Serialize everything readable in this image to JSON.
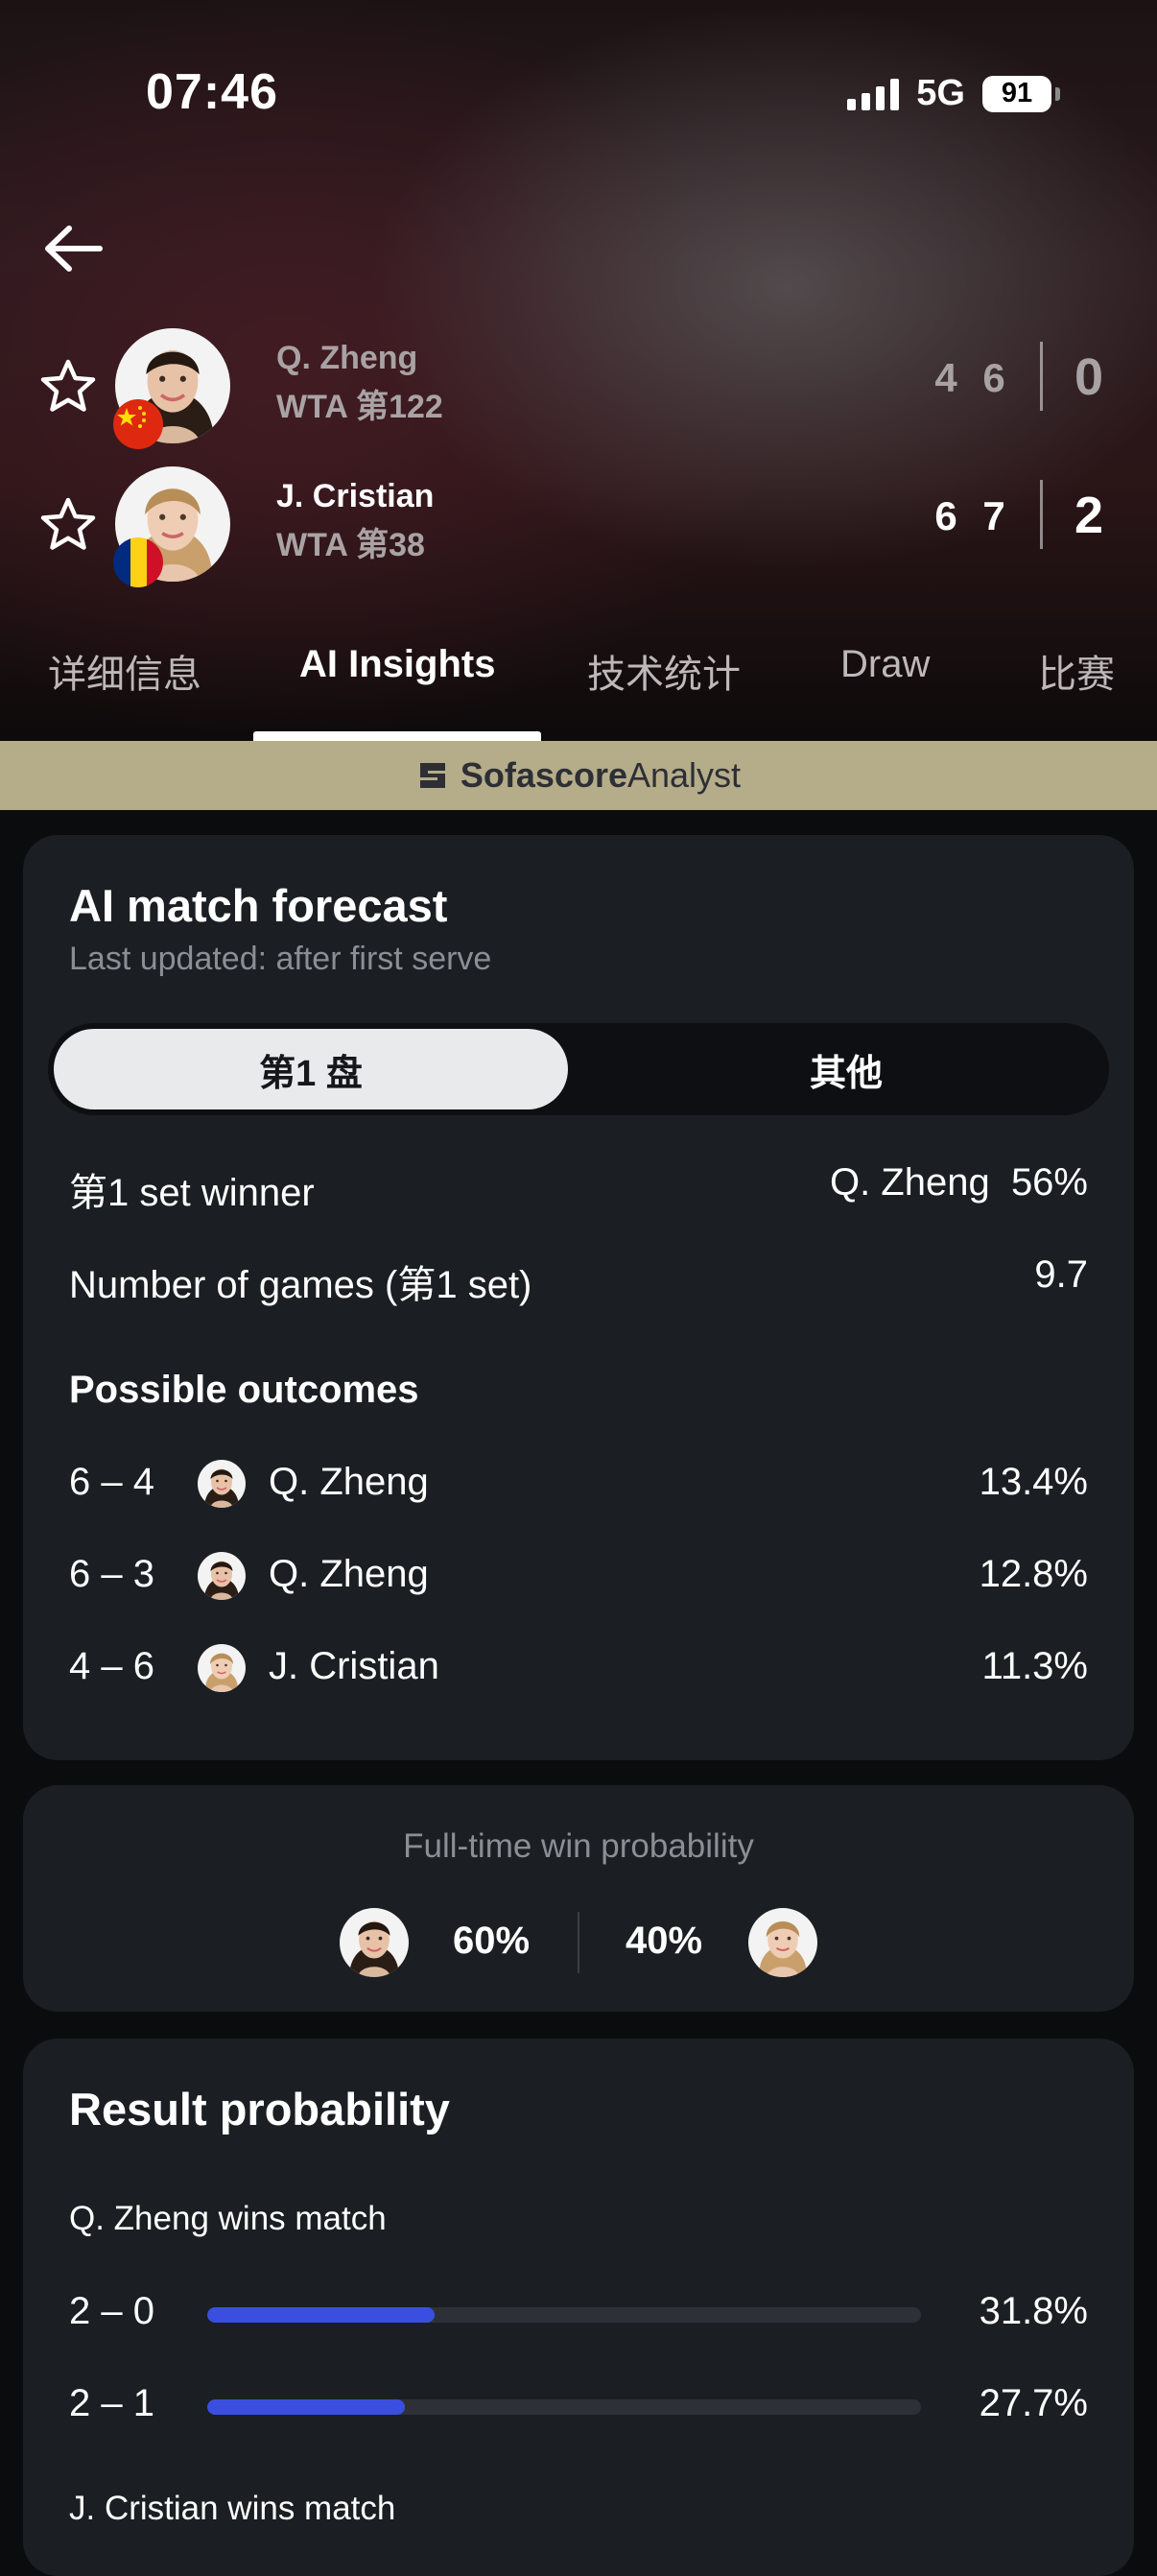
{
  "status_bar": {
    "time": "07:46",
    "network": "5G",
    "battery": "91"
  },
  "match": {
    "players": [
      {
        "name": "Q. Zheng",
        "rank": "WTA 第122",
        "sets": [
          "4",
          "6"
        ],
        "total": "0",
        "flag": "china-flag"
      },
      {
        "name": "J. Cristian",
        "rank": "WTA 第38",
        "sets": [
          "6",
          "7"
        ],
        "total": "2",
        "flag": "romania-flag"
      }
    ]
  },
  "tabs": [
    {
      "label": "详细信息",
      "active": false
    },
    {
      "label": "AI Insights",
      "active": true
    },
    {
      "label": "技术统计",
      "active": false
    },
    {
      "label": "Draw",
      "active": false
    },
    {
      "label": "比赛",
      "active": false
    }
  ],
  "analyst_banner": {
    "brand_bold": "Sofascore",
    "brand_light": "Analyst"
  },
  "forecast": {
    "title": "AI match forecast",
    "subtitle": "Last updated: after first serve",
    "toggle": {
      "selected": "第1 盘",
      "other": "其他"
    },
    "set_winner_label": "第1 set winner",
    "set_winner_value": "Q. Zheng  56%",
    "games_label": "Number of games (第1 set)",
    "games_value": "9.7",
    "outcomes_heading": "Possible outcomes",
    "outcomes": [
      {
        "score": "6 – 4",
        "player": "Q. Zheng",
        "pct": "13.4%"
      },
      {
        "score": "6 – 3",
        "player": "Q. Zheng",
        "pct": "12.8%"
      },
      {
        "score": "4 – 6",
        "player": "J. Cristian",
        "pct": "11.3%"
      }
    ]
  },
  "win_probability": {
    "title": "Full-time win probability",
    "left_pct": "60%",
    "right_pct": "40%"
  },
  "result_probability": {
    "title": "Result probability",
    "heading_1": "Q. Zheng wins match",
    "rows": [
      {
        "score": "2 – 0",
        "pct": "31.8%",
        "fraction": 0.318
      },
      {
        "score": "2 – 1",
        "pct": "27.7%",
        "fraction": 0.277
      }
    ],
    "heading_2": "J. Cristian wins match"
  },
  "colors": {
    "accent_bar": "#3a4fe0",
    "banner": "#b5ac89",
    "card": "#1b1e22"
  }
}
